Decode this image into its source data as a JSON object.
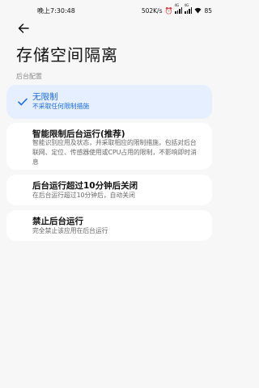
{
  "status_bar": {
    "time": "晚上7:30:48",
    "network_speed": "502K/s",
    "alarm_icon": "alarm-clock-icon",
    "signal1_tag": "4G",
    "signal2_tag": "4G",
    "battery": "85"
  },
  "header": {
    "back_icon": "back-arrow-icon",
    "title": "存储空间隔离"
  },
  "section_label": "后台配置",
  "options": [
    {
      "title": "无限制",
      "description": "不采取任何限制措施",
      "selected": true
    },
    {
      "title": "智能限制后台运行(推荐)",
      "description": "智能识别应用及状态，并采取相应的限制措施，包括对后台联网、定位、传感器使用或CPU占用的限制，不影响即时消息",
      "selected": false
    },
    {
      "title": "后台运行超过10分钟后关闭",
      "description": "在后台运行超过10分钟后，自动关闭",
      "selected": false
    },
    {
      "title": "禁止后台运行",
      "description": "完全禁止该应用在后台运行",
      "selected": false
    }
  ],
  "colors": {
    "accent": "#1a6cf2",
    "selected_bg": "#e5efff",
    "page_bg": "#f7f7f7"
  }
}
